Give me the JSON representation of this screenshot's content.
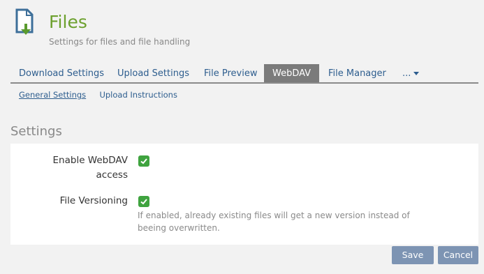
{
  "header": {
    "title": "Files",
    "subtitle": "Settings for files and file handling",
    "icon": "file-download-icon",
    "accent_color": "#6ca02e"
  },
  "tabs": [
    {
      "label": "Download Settings",
      "active": false
    },
    {
      "label": "Upload Settings",
      "active": false
    },
    {
      "label": "File Preview",
      "active": false
    },
    {
      "label": "WebDAV",
      "active": true
    },
    {
      "label": "File Manager",
      "active": false
    },
    {
      "label": "...",
      "active": false
    }
  ],
  "subnav": [
    {
      "label": "General Settings",
      "active": true
    },
    {
      "label": "Upload Instructions",
      "active": false
    }
  ],
  "section": {
    "title": "Settings",
    "fields": [
      {
        "label": "Enable WebDAV access",
        "checked": true
      },
      {
        "label": "File Versioning",
        "checked": true,
        "help": "If enabled, already existing files will get a new version instead of beeing overwritten."
      }
    ]
  },
  "buttons": {
    "save": "Save",
    "cancel": "Cancel"
  },
  "colors": {
    "checkbox": "#3fa33f",
    "button": "#7d94b3",
    "link": "#2d5d8e"
  }
}
